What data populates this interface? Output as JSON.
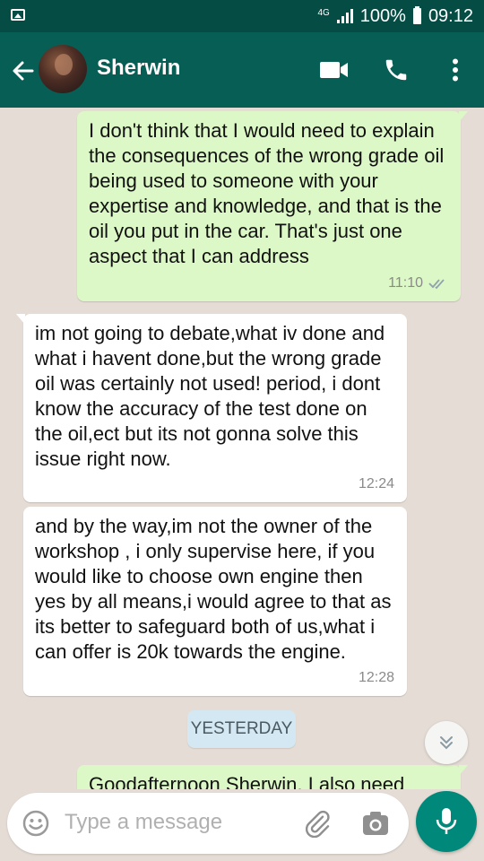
{
  "status_bar": {
    "network": "4G",
    "battery": "100%",
    "time": "09:12"
  },
  "header": {
    "contact_name": "Sherwin",
    "icons": [
      "back-arrow-icon",
      "video-call-icon",
      "phone-icon",
      "more-vert-icon"
    ]
  },
  "messages": [
    {
      "direction": "outgoing",
      "text": "I don't think that I would need to explain the consequences of the wrong grade oil being used to someone with your expertise and knowledge, and that is the oil you put in the car. That's just one aspect that I can address",
      "time": "11:10",
      "status": "read"
    },
    {
      "direction": "incoming",
      "text": "im not going to debate,what iv done and what i havent done,but the wrong grade oil was certainly not used! period, i dont know the accuracy of the test done on the oil,ect but its not gonna solve this issue right now.",
      "time": "12:24"
    },
    {
      "direction": "incoming",
      "text": "and by the way,im not the owner of the workshop , i only supervise here, if you would like to choose own engine then yes by all means,i would agree to that as its better to safeguard both of us,what i can offer is 20k towards the engine.",
      "time": "12:28"
    },
    {
      "direction": "outgoing",
      "text": "Goodafternoon Sherwin, I also need",
      "time": ""
    }
  ],
  "date_divider": "YESTERDAY",
  "composer": {
    "placeholder": "Type a message"
  },
  "colors": {
    "status_bar": "#054d44",
    "app_bar": "#075e54",
    "outgoing_bubble": "#dcf8c6",
    "incoming_bubble": "#ffffff",
    "mic_button": "#00897b",
    "date_chip": "#d3e8f2"
  }
}
